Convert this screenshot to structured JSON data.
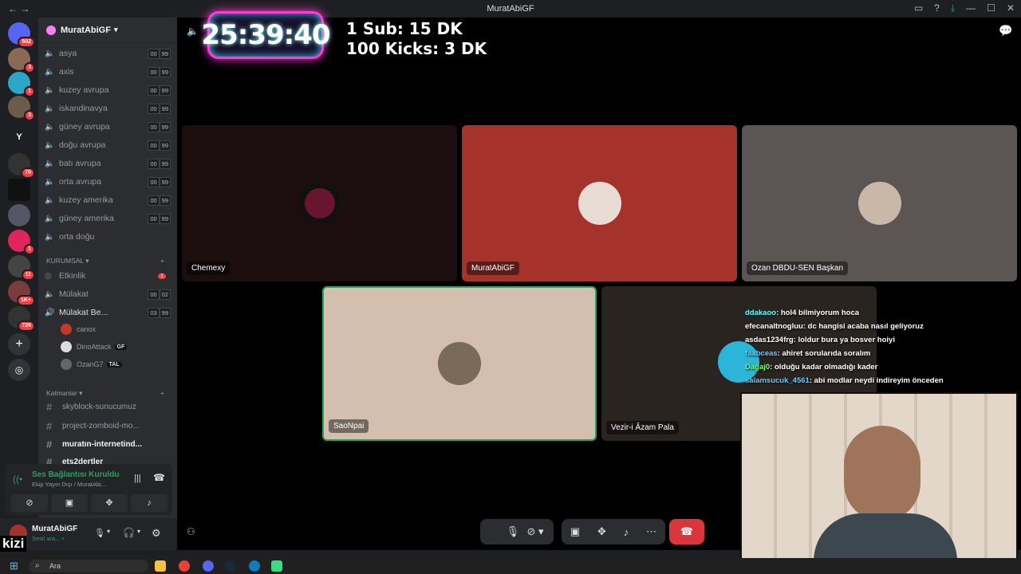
{
  "window": {
    "title": "MuratAbiGF"
  },
  "sidebar_servers": {
    "dm_badge": "502",
    "badges": [
      "3",
      "1",
      "3",
      "70",
      "1",
      "11",
      "1K+",
      "726"
    ],
    "y_label": "Y"
  },
  "guild": {
    "name": "MuratAbiGF"
  },
  "voice_channels": [
    {
      "name": "asya",
      "a": "00",
      "b": "99"
    },
    {
      "name": "axis",
      "a": "00",
      "b": "99"
    },
    {
      "name": "kuzey avrupa",
      "a": "00",
      "b": "99"
    },
    {
      "name": "iskandinavya",
      "a": "00",
      "b": "99"
    },
    {
      "name": "güney avrupa",
      "a": "00",
      "b": "99"
    },
    {
      "name": "doğu avrupa",
      "a": "00",
      "b": "99"
    },
    {
      "name": "batı avrupa",
      "a": "00",
      "b": "99"
    },
    {
      "name": "orta avrupa",
      "a": "00",
      "b": "99"
    },
    {
      "name": "kuzey amerika",
      "a": "00",
      "b": "99"
    },
    {
      "name": "güney amerika",
      "a": "00",
      "b": "99"
    },
    {
      "name": "orta doğu"
    }
  ],
  "category_kurumsal": {
    "label": "KURUMSAL"
  },
  "kurumsal_channels": [
    {
      "name": "Etkinlik",
      "badge": "1"
    },
    {
      "name": "Mülakat",
      "a": "00",
      "b": "02"
    },
    {
      "name": "Mülakat Be...",
      "a": "03",
      "b": "99"
    }
  ],
  "members": [
    {
      "name": "canox",
      "tag": ""
    },
    {
      "name": "DinoAttack",
      "tag": "GF"
    },
    {
      "name": "OzanG7",
      "tag": "TAL"
    }
  ],
  "category_katmanlar": {
    "label": "Katmanlar"
  },
  "text_channels": [
    "skyblock-sunucumuz",
    "project-zomboid-mo...",
    "muratın-internetind...",
    "ets2dertler"
  ],
  "voice_status": {
    "title": "Ses Bağlantısı Kuruldu",
    "subtitle": "Ekip Yayın Dışı / MuratAbi..."
  },
  "user": {
    "name": "MuratAbiGF",
    "status": "Sesli ara... •"
  },
  "overlay": {
    "timer": "25:39:40",
    "line1": "1 Sub: 15 DK",
    "line2": "100 Kicks: 3 DK",
    "corner_label": "kizi"
  },
  "tiles": [
    {
      "name": "Chemexy"
    },
    {
      "name": "MuratAbiGF"
    },
    {
      "name": "Ozan DBDU-SEN Başkan"
    },
    {
      "name": "SaoNpai"
    },
    {
      "name": "Vezir-i Âzam Pala"
    }
  ],
  "stream_chat": [
    {
      "user": "ddakaoo",
      "msg": ": hol4 bilmiyorum hoca",
      "color": "#6ff"
    },
    {
      "user": "efecanaltnogluu",
      "msg": ": dc hangisi acaba nasıl geliyoruz",
      "color": "#fff"
    },
    {
      "user": "asdas1234frg",
      "msg": ": loldur bura ya bosver hoiyi",
      "color": "#fff"
    },
    {
      "user": "faabceas",
      "msg": ": ahiret sorularıda soralım",
      "color": "#6cf"
    },
    {
      "user": "Dagaj0",
      "msg": ": olduğu kadar olmadığı kader",
      "color": "#7f7"
    },
    {
      "user": "salamsucuk_4561",
      "msg": ": abi modlar neydi indireyim önceden",
      "color": "#6cf"
    }
  ],
  "taskbar": {
    "search_placeholder": "Ara"
  },
  "colors": {
    "accent": "#23a55a",
    "hangup": "#da373c",
    "tile_red": "#a6322c",
    "tile_grey": "#5b5553",
    "tile_beige": "#d4bfae"
  }
}
